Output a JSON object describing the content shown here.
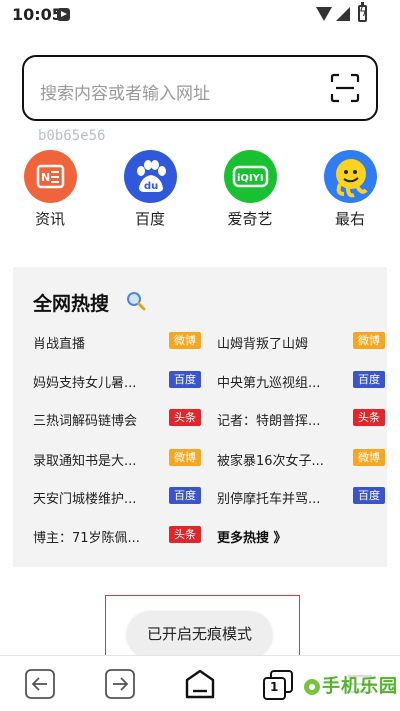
{
  "status_bar": {
    "time": "10:05"
  },
  "search": {
    "placeholder": "搜索内容或者输入网址",
    "device_id": "b0b65e56"
  },
  "shortcuts": [
    {
      "label": "资讯",
      "icon": "news-icon",
      "color": "#f0643c",
      "glyph": "NE"
    },
    {
      "label": "百度",
      "icon": "baidu-icon",
      "color": "#3059d9",
      "glyph": "du"
    },
    {
      "label": "爱奇艺",
      "icon": "iqiyi-icon",
      "color": "#19c032",
      "glyph": "iQIYI"
    },
    {
      "label": "最右",
      "icon": "zuiyou-icon",
      "color": "#2f7df0",
      "glyph": ""
    }
  ],
  "hot_search": {
    "title": "全网热搜",
    "items": [
      {
        "text": "肖战直播",
        "badge": "微博",
        "badge_color": "#f5a623"
      },
      {
        "text": "山姆背叛了山姆",
        "badge": "微博",
        "badge_color": "#f5a623"
      },
      {
        "text": "妈妈支持女儿暑...",
        "badge": "百度",
        "badge_color": "#3a55c9"
      },
      {
        "text": "中央第九巡视组...",
        "badge": "百度",
        "badge_color": "#3a55c9"
      },
      {
        "text": "三热词解码链博会",
        "badge": "头条",
        "badge_color": "#e0252b"
      },
      {
        "text": "记者：特朗普挥...",
        "badge": "头条",
        "badge_color": "#e0252b"
      },
      {
        "text": "录取通知书是大...",
        "badge": "微博",
        "badge_color": "#f5a623"
      },
      {
        "text": "被家暴16次女子...",
        "badge": "微博",
        "badge_color": "#f5a623"
      },
      {
        "text": "天安门城楼维护...",
        "badge": "百度",
        "badge_color": "#3a55c9"
      },
      {
        "text": "别停摩托车并骂...",
        "badge": "百度",
        "badge_color": "#3a55c9"
      },
      {
        "text": "博主：71岁陈佩...",
        "badge": "头条",
        "badge_color": "#e0252b"
      }
    ],
    "more_label": "更多热搜 》"
  },
  "toast": {
    "text": "已开启无痕模式"
  },
  "bottom_nav": {
    "tab_count": "1",
    "icons": [
      "back-arrow-icon",
      "forward-arrow-icon",
      "home-icon",
      "tabs-icon",
      "menu-icon"
    ]
  },
  "watermark": {
    "text": "手机乐园"
  }
}
